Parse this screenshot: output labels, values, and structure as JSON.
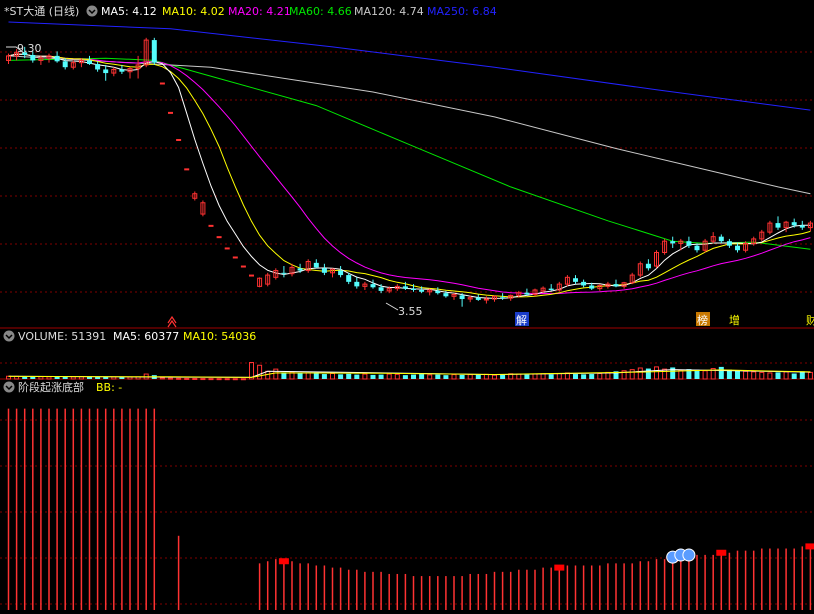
{
  "colors": {
    "background": "#000000",
    "up": "#ff3232",
    "down": "#54fcfc",
    "grid": "#800000",
    "ma5": "#ffffff",
    "ma10": "#ffff00",
    "ma20": "#ff00ff",
    "ma60": "#00e600",
    "ma120": "#c8c8c8",
    "ma250": "#2222ff",
    "header_text": "#dddddd",
    "signal_marker": "#ff0000",
    "bubble": "#5a9cff"
  },
  "price_panel": {
    "title": "*ST大通 (日线)",
    "ma_labels": [
      {
        "key": "ma5",
        "label": "MA5: 4.12"
      },
      {
        "key": "ma10",
        "label": "MA10: 4.02"
      },
      {
        "key": "ma20",
        "label": "MA20: 4.21"
      },
      {
        "key": "ma60",
        "label": "MA60: 4.66"
      },
      {
        "key": "ma120",
        "label": "MA120: 4.74"
      },
      {
        "key": "ma250",
        "label": "MA250: 6.84"
      }
    ],
    "high_label": "9.30",
    "low_label": "3.55",
    "event_markers": [
      "解",
      "榜",
      "增",
      "财"
    ]
  },
  "volume_panel": {
    "labels": [
      {
        "key": "volume",
        "label": "VOLUME: 51391"
      },
      {
        "key": "ma5",
        "label": "MA5: 60377"
      },
      {
        "key": "ma10",
        "label": "MA10: 54036"
      }
    ]
  },
  "indicator_panel": {
    "title": "阶段起涨底部",
    "value_label": "BB: -"
  },
  "chart_data": [
    {
      "type": "candlestick",
      "title": "*ST大通 (日线)",
      "yrange": [
        3.3,
        9.85
      ],
      "n": 100,
      "annotations": {
        "max": 9.3,
        "min": 3.55
      },
      "ohlc": [
        [
          9.0,
          9.15,
          8.92,
          9.1
        ],
        [
          9.1,
          9.25,
          9.0,
          9.18
        ],
        [
          9.18,
          9.3,
          9.05,
          9.12
        ],
        [
          9.12,
          9.2,
          8.95,
          9.0
        ],
        [
          9.0,
          9.1,
          8.9,
          9.05
        ],
        [
          9.05,
          9.15,
          8.95,
          9.1
        ],
        [
          9.1,
          9.2,
          8.95,
          8.98
        ],
        [
          8.98,
          9.05,
          8.8,
          8.85
        ],
        [
          8.85,
          9.0,
          8.8,
          8.95
        ],
        [
          8.95,
          9.05,
          8.85,
          9.0
        ],
        [
          9.0,
          9.1,
          8.9,
          8.92
        ],
        [
          8.92,
          8.98,
          8.75,
          8.8
        ],
        [
          8.8,
          8.9,
          8.55,
          8.72
        ],
        [
          8.72,
          8.85,
          8.65,
          8.8
        ],
        [
          8.8,
          8.9,
          8.7,
          8.75
        ],
        [
          8.75,
          8.85,
          8.6,
          8.82
        ],
        [
          8.82,
          9.1,
          8.6,
          8.9
        ],
        [
          8.9,
          9.5,
          8.85,
          9.45
        ],
        [
          9.45,
          9.5,
          8.9,
          8.95
        ],
        [
          8.5,
          8.5,
          8.5,
          8.5
        ],
        [
          7.85,
          7.85,
          7.85,
          7.85
        ],
        [
          7.25,
          7.25,
          7.25,
          7.25
        ],
        [
          6.6,
          6.6,
          6.6,
          6.6
        ],
        [
          5.95,
          6.1,
          5.9,
          6.05
        ],
        [
          5.6,
          5.9,
          5.55,
          5.85
        ],
        [
          5.35,
          5.35,
          5.35,
          5.35
        ],
        [
          5.1,
          5.1,
          5.1,
          5.1
        ],
        [
          4.85,
          4.85,
          4.85,
          4.85
        ],
        [
          4.65,
          4.65,
          4.65,
          4.65
        ],
        [
          4.45,
          4.45,
          4.45,
          4.45
        ],
        [
          4.25,
          4.25,
          4.25,
          4.25
        ],
        [
          4.0,
          4.2,
          3.98,
          4.18
        ],
        [
          4.05,
          4.3,
          4.0,
          4.25
        ],
        [
          4.2,
          4.4,
          4.15,
          4.35
        ],
        [
          4.3,
          4.45,
          4.2,
          4.28
        ],
        [
          4.28,
          4.5,
          4.22,
          4.42
        ],
        [
          4.4,
          4.5,
          4.3,
          4.35
        ],
        [
          4.35,
          4.6,
          4.3,
          4.55
        ],
        [
          4.52,
          4.6,
          4.4,
          4.42
        ],
        [
          4.4,
          4.5,
          4.25,
          4.3
        ],
        [
          4.3,
          4.4,
          4.2,
          4.38
        ],
        [
          4.35,
          4.45,
          4.2,
          4.25
        ],
        [
          4.25,
          4.3,
          4.05,
          4.1
        ],
        [
          4.1,
          4.2,
          3.95,
          4.0
        ],
        [
          4.0,
          4.1,
          3.92,
          4.05
        ],
        [
          4.05,
          4.15,
          3.95,
          3.98
        ],
        [
          3.98,
          4.05,
          3.85,
          3.9
        ],
        [
          3.9,
          4.0,
          3.85,
          3.95
        ],
        [
          3.95,
          4.05,
          3.9,
          4.0
        ],
        [
          4.0,
          4.1,
          3.92,
          3.95
        ],
        [
          3.95,
          4.05,
          3.88,
          3.92
        ],
        [
          3.92,
          4.0,
          3.85,
          3.88
        ],
        [
          3.88,
          3.95,
          3.8,
          3.92
        ],
        [
          3.9,
          3.98,
          3.82,
          3.85
        ],
        [
          3.85,
          3.9,
          3.75,
          3.78
        ],
        [
          3.78,
          3.85,
          3.7,
          3.82
        ],
        [
          3.8,
          3.85,
          3.55,
          3.72
        ],
        [
          3.72,
          3.8,
          3.65,
          3.75
        ],
        [
          3.75,
          3.82,
          3.68,
          3.7
        ],
        [
          3.7,
          3.78,
          3.62,
          3.72
        ],
        [
          3.72,
          3.8,
          3.66,
          3.78
        ],
        [
          3.76,
          3.85,
          3.7,
          3.74
        ],
        [
          3.74,
          3.82,
          3.68,
          3.8
        ],
        [
          3.8,
          3.9,
          3.75,
          3.86
        ],
        [
          3.86,
          3.95,
          3.8,
          3.82
        ],
        [
          3.82,
          3.95,
          3.78,
          3.92
        ],
        [
          3.9,
          4.0,
          3.85,
          3.96
        ],
        [
          3.95,
          4.05,
          3.9,
          3.92
        ],
        [
          3.92,
          4.1,
          3.88,
          4.05
        ],
        [
          4.05,
          4.25,
          4.0,
          4.2
        ],
        [
          4.18,
          4.25,
          4.05,
          4.1
        ],
        [
          4.1,
          4.15,
          3.98,
          4.02
        ],
        [
          4.02,
          4.08,
          3.92,
          3.95
        ],
        [
          3.95,
          4.05,
          3.9,
          4.02
        ],
        [
          4.0,
          4.1,
          3.95,
          4.05
        ],
        [
          4.05,
          4.15,
          3.98,
          4.0
        ],
        [
          4.0,
          4.1,
          3.95,
          4.08
        ],
        [
          4.08,
          4.3,
          4.05,
          4.25
        ],
        [
          4.25,
          4.55,
          4.2,
          4.5
        ],
        [
          4.5,
          4.6,
          4.35,
          4.4
        ],
        [
          4.45,
          4.8,
          4.4,
          4.75
        ],
        [
          4.75,
          5.05,
          4.7,
          5.0
        ],
        [
          5.0,
          5.1,
          4.85,
          4.95
        ],
        [
          4.95,
          5.05,
          4.8,
          5.0
        ],
        [
          5.0,
          5.1,
          4.85,
          4.9
        ],
        [
          4.9,
          4.95,
          4.75,
          4.8
        ],
        [
          4.8,
          5.05,
          4.75,
          5.0
        ],
        [
          5.0,
          5.2,
          4.95,
          5.1
        ],
        [
          5.1,
          5.15,
          4.95,
          5.0
        ],
        [
          5.0,
          5.05,
          4.85,
          4.9
        ],
        [
          4.9,
          4.95,
          4.75,
          4.8
        ],
        [
          4.8,
          5.0,
          4.75,
          4.95
        ],
        [
          4.95,
          5.1,
          4.9,
          5.05
        ],
        [
          5.05,
          5.25,
          5.0,
          5.2
        ],
        [
          5.2,
          5.45,
          5.15,
          5.4
        ],
        [
          5.4,
          5.55,
          5.25,
          5.3
        ],
        [
          5.3,
          5.45,
          5.2,
          5.42
        ],
        [
          5.42,
          5.5,
          5.3,
          5.35
        ],
        [
          5.35,
          5.45,
          5.25,
          5.3
        ],
        [
          5.3,
          5.45,
          5.22,
          5.4
        ]
      ],
      "moving_averages": [
        {
          "name": "MA60",
          "key": "ma60",
          "points": [
            [
              0,
              9.0
            ],
            [
              12,
              9.05
            ],
            [
              18,
              9.0
            ],
            [
              26,
              8.6
            ],
            [
              38,
              8.0
            ],
            [
              50,
              7.1
            ],
            [
              62,
              6.2
            ],
            [
              74,
              5.45
            ],
            [
              82,
              5.0
            ],
            [
              86,
              4.95
            ],
            [
              92,
              4.98
            ],
            [
              99,
              4.82
            ]
          ]
        },
        {
          "name": "MA120",
          "key": "ma120",
          "points": [
            [
              0,
              9.1
            ],
            [
              25,
              8.85
            ],
            [
              45,
              8.3
            ],
            [
              60,
              7.75
            ],
            [
              75,
              7.05
            ],
            [
              88,
              6.5
            ],
            [
              95,
              6.2
            ],
            [
              99,
              6.05
            ]
          ]
        },
        {
          "name": "MA250",
          "key": "ma250",
          "points": [
            [
              0,
              9.85
            ],
            [
              20,
              9.7
            ],
            [
              40,
              9.3
            ],
            [
              60,
              8.85
            ],
            [
              80,
              8.35
            ],
            [
              99,
              7.9
            ]
          ]
        }
      ],
      "volume": {
        "yrange": [
          0,
          60000
        ],
        "values": [
          5000,
          4800,
          5200,
          4500,
          4200,
          4000,
          4100,
          3800,
          3900,
          4000,
          3600,
          3500,
          3700,
          3600,
          3400,
          3500,
          3800,
          9000,
          7000,
          2000,
          1500,
          1200,
          1000,
          900,
          800,
          700,
          650,
          600,
          550,
          500,
          30000,
          25000,
          14000,
          18000,
          12000,
          13000,
          10000,
          11000,
          12000,
          9000,
          10000,
          8500,
          9500,
          8000,
          9000,
          7500,
          8000,
          9000,
          8500,
          7000,
          8000,
          9000,
          7500,
          8000,
          7000,
          8000,
          7500,
          8000,
          9000,
          8500,
          7000,
          8000,
          9500,
          9000,
          8000,
          9000,
          9500,
          8500,
          10000,
          11000,
          9000,
          8500,
          9000,
          10000,
          12000,
          14000,
          15000,
          17000,
          20000,
          19000,
          22000,
          18000,
          21000,
          16000,
          18000,
          17000,
          15000,
          19000,
          22000,
          17000,
          15000,
          14000,
          13000,
          12000,
          11000,
          12000,
          13000,
          10000,
          14000,
          12000
        ],
        "ma5": [
          [
            0,
            5000
          ],
          [
            20,
            3500
          ],
          [
            30,
            3000
          ],
          [
            32,
            14000
          ],
          [
            40,
            12500
          ],
          [
            60,
            8000
          ],
          [
            75,
            11000
          ],
          [
            82,
            17000
          ],
          [
            99,
            12500
          ]
        ],
        "ma10": [
          [
            0,
            4800
          ],
          [
            20,
            4000
          ],
          [
            30,
            3000
          ],
          [
            33,
            11000
          ],
          [
            45,
            10500
          ],
          [
            60,
            8200
          ],
          [
            78,
            12500
          ],
          [
            88,
            16500
          ],
          [
            99,
            13000
          ]
        ]
      },
      "indicator": {
        "name": "阶段起涨底部",
        "yrange": [
          0,
          100
        ],
        "bars": [
          95,
          95,
          95,
          95,
          95,
          95,
          95,
          95,
          95,
          95,
          95,
          95,
          95,
          95,
          95,
          95,
          95,
          95,
          95,
          0,
          0,
          35,
          0,
          0,
          0,
          0,
          0,
          0,
          0,
          0,
          0,
          22,
          23,
          24,
          23,
          23,
          22,
          22,
          21,
          21,
          20,
          20,
          19,
          19,
          18,
          18,
          18,
          17,
          17,
          17,
          16,
          16,
          16,
          16,
          16,
          16,
          16,
          17,
          17,
          17,
          18,
          18,
          18,
          19,
          19,
          19,
          20,
          20,
          20,
          21,
          21,
          21,
          21,
          21,
          22,
          22,
          22,
          22,
          23,
          23,
          24,
          24,
          24,
          25,
          25,
          26,
          26,
          26,
          27,
          27,
          28,
          28,
          28,
          29,
          29,
          29,
          29,
          29,
          30,
          30
        ],
        "signals": [
          34,
          68,
          82,
          88,
          99
        ],
        "bubbles": [
          82,
          83,
          84
        ]
      }
    }
  ]
}
